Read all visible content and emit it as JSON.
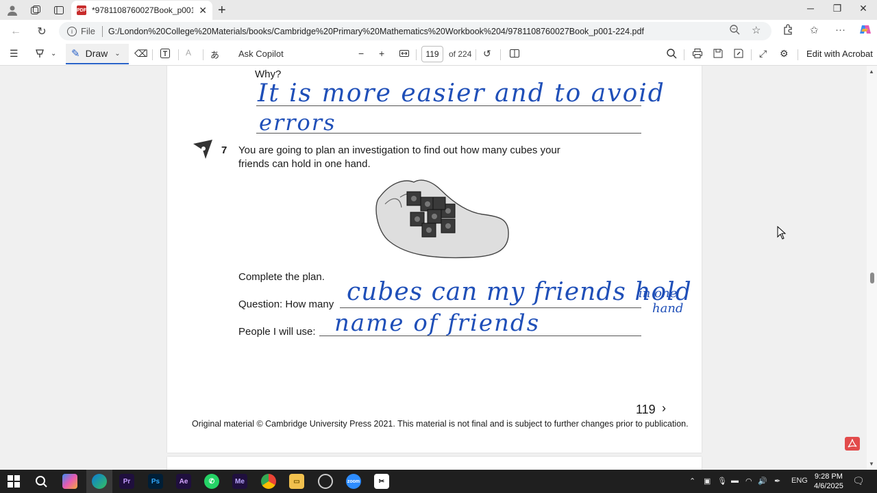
{
  "browser": {
    "tab_title": "*9781108760027Book_p001-224.pdf",
    "file_label": "File",
    "url": "G:/London%20College%20Materials/books/Cambridge%20Primary%20Mathematics%20Workbook%204/9781108760027Book_p001-224.pdf"
  },
  "pdf_toolbar": {
    "draw_label": "Draw",
    "ask_copilot": "Ask Copilot",
    "page_current": "119",
    "page_total": "of 224",
    "edit_acrobat": "Edit with Acrobat"
  },
  "page": {
    "why_label": "Why?",
    "answer_line1": "It is more easier and to avoid",
    "answer_line2": "errors",
    "q7_number": "7",
    "q7_text_line1": "You are going to plan an investigation to find out how many cubes your",
    "q7_text_line2": "friends can hold in one hand.",
    "complete_plan": "Complete the plan.",
    "question_label": "Question: How many",
    "question_answer": "cubes can my friends hold",
    "question_answer_tail1": "in one",
    "question_answer_tail2": "hand",
    "people_label": "People I will use:",
    "people_answer": "name of friends",
    "page_number": "119",
    "copyright": "Original material © Cambridge University Press 2021. This material is not final and is subject to further changes prior to publication."
  },
  "taskbar": {
    "lang": "ENG",
    "time": "9:28 PM",
    "date": "4/6/2025"
  },
  "colors": {
    "ink": "#1f4fb8",
    "accent": "#2962c8"
  }
}
